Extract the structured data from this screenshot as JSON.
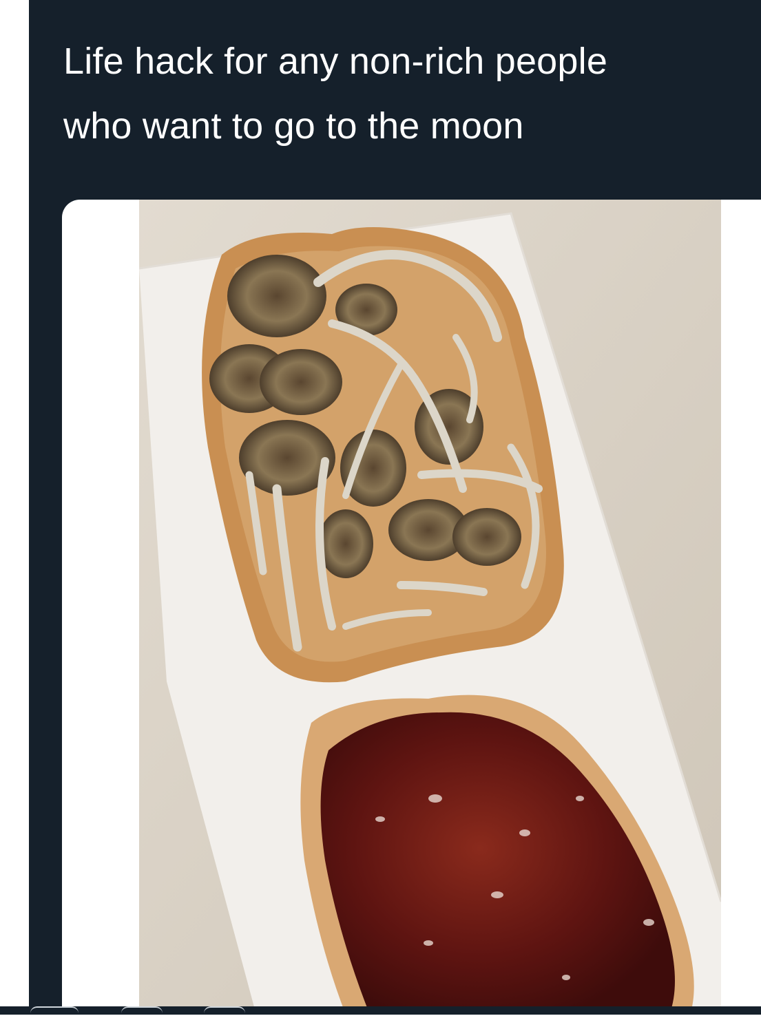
{
  "tweet": {
    "caption_line_1": "Life hack for any non-rich people",
    "caption_line_2": "who want to go to the moon"
  },
  "media": {
    "type": "photo"
  },
  "colors": {
    "panel_background": "#15202b",
    "caption_text": "#ffffff",
    "counter_surface": "#d9d2c5",
    "paper_towel": "#f3f1ee",
    "bread_crust": "#c98f52",
    "peanut_butter": "#d3a26a",
    "mushroom_cap": "#6b5a40",
    "mushroom_stem": "#ded8cc",
    "jam": "#6a1414"
  },
  "icons": [
    "reply-icon",
    "retweet-icon",
    "like-icon"
  ]
}
